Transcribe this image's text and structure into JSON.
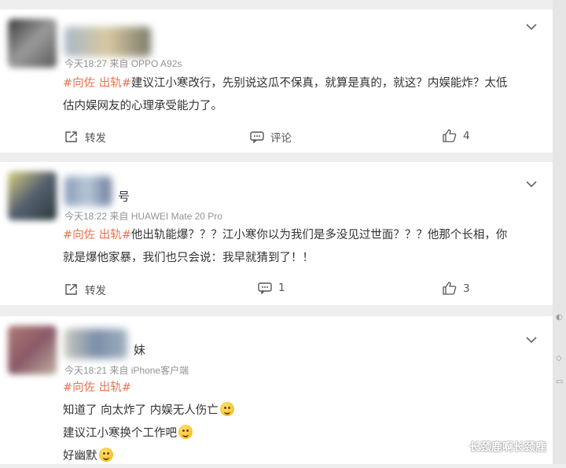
{
  "comments": [
    {
      "name_suffix": "",
      "meta": "今天18:27 来自 OPPO A92s",
      "tags": "#向佐 出轨#",
      "lines": [
        "建议江小寒改行，先别说这瓜不保真，就算是真的，就这？内娱能炸？太低",
        "估内娱网友的心理承受能力了。"
      ],
      "repost": "转发",
      "comment": "评论",
      "likes": "4"
    },
    {
      "name_suffix": "号",
      "meta": "今天18:22 来自 HUAWEI Mate 20 Pro",
      "tags": "#向佐 出轨#",
      "lines": [
        "他出轨能爆？？？江小寒你以为我们是多没见过世面？？？他那个长相，你",
        "就是爆他家暴，我们也只会说：我早就猜到了！！"
      ],
      "repost": "转发",
      "comment": "1",
      "likes": "3"
    },
    {
      "name_suffix": "妹",
      "meta": "今天18:21 来自 iPhone客户端",
      "tags": "#向佐 出轨#",
      "lines": [
        "知道了 向太炸了 内娱无人伤亡",
        "建议江小寒换个工作吧",
        "好幽默"
      ]
    }
  ],
  "watermark": "长颈鹿啊长颈鹿",
  "icons": {
    "more": "chevron-down-icon",
    "repost": "share-icon",
    "comment": "comment-icon",
    "like": "thumbs-up-icon",
    "emoji": "smile-emoji-icon"
  },
  "colors": {
    "tag": "#eb7350",
    "text": "#333333",
    "meta": "#939393"
  }
}
